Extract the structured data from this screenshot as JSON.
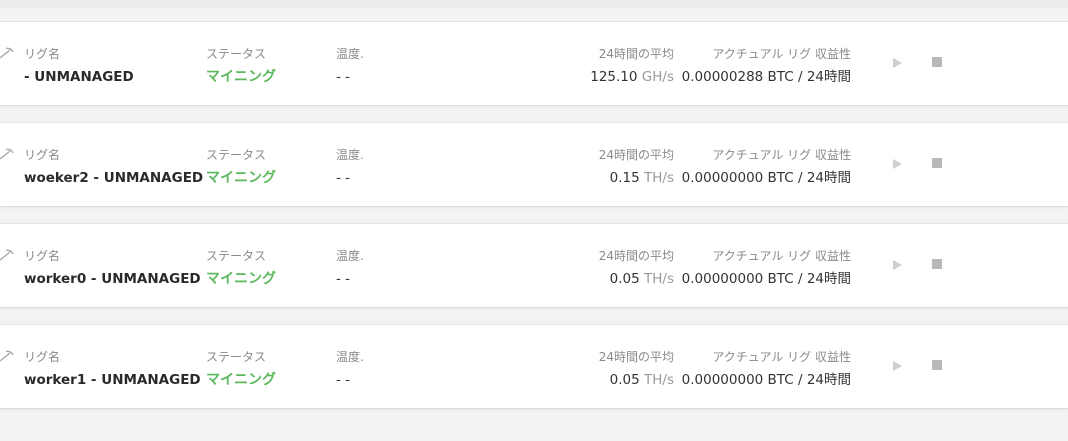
{
  "labels": {
    "rig_name": "リグ名",
    "status": "ステータス",
    "temperature": "温度.",
    "avg_24h": "24時間の平均",
    "profitability": "アクチュアル リグ 収益性"
  },
  "rigs": [
    {
      "name": "- UNMANAGED",
      "status": "マイニング",
      "temperature": "- -",
      "avg_value": "125.10",
      "avg_unit": "GH/s",
      "profitability": "0.00000288 BTC / 24時間"
    },
    {
      "name": "woeker2 - UNMANAGED",
      "status": "マイニング",
      "temperature": "- -",
      "avg_value": "0.15",
      "avg_unit": "TH/s",
      "profitability": "0.00000000 BTC / 24時間"
    },
    {
      "name": "worker0 - UNMANAGED",
      "status": "マイニング",
      "temperature": "- -",
      "avg_value": "0.05",
      "avg_unit": "TH/s",
      "profitability": "0.00000000 BTC / 24時間"
    },
    {
      "name": "worker1 - UNMANAGED",
      "status": "マイニング",
      "temperature": "- -",
      "avg_value": "0.05",
      "avg_unit": "TH/s",
      "profitability": "0.00000000 BTC / 24時間"
    }
  ],
  "icons": {
    "rig": "pickaxe-icon",
    "start": "play-icon",
    "stop": "stop-icon"
  },
  "colors": {
    "status_mining": "#5cb85c",
    "label": "#8a8a8a",
    "control_icon": "#b8b8b8"
  }
}
